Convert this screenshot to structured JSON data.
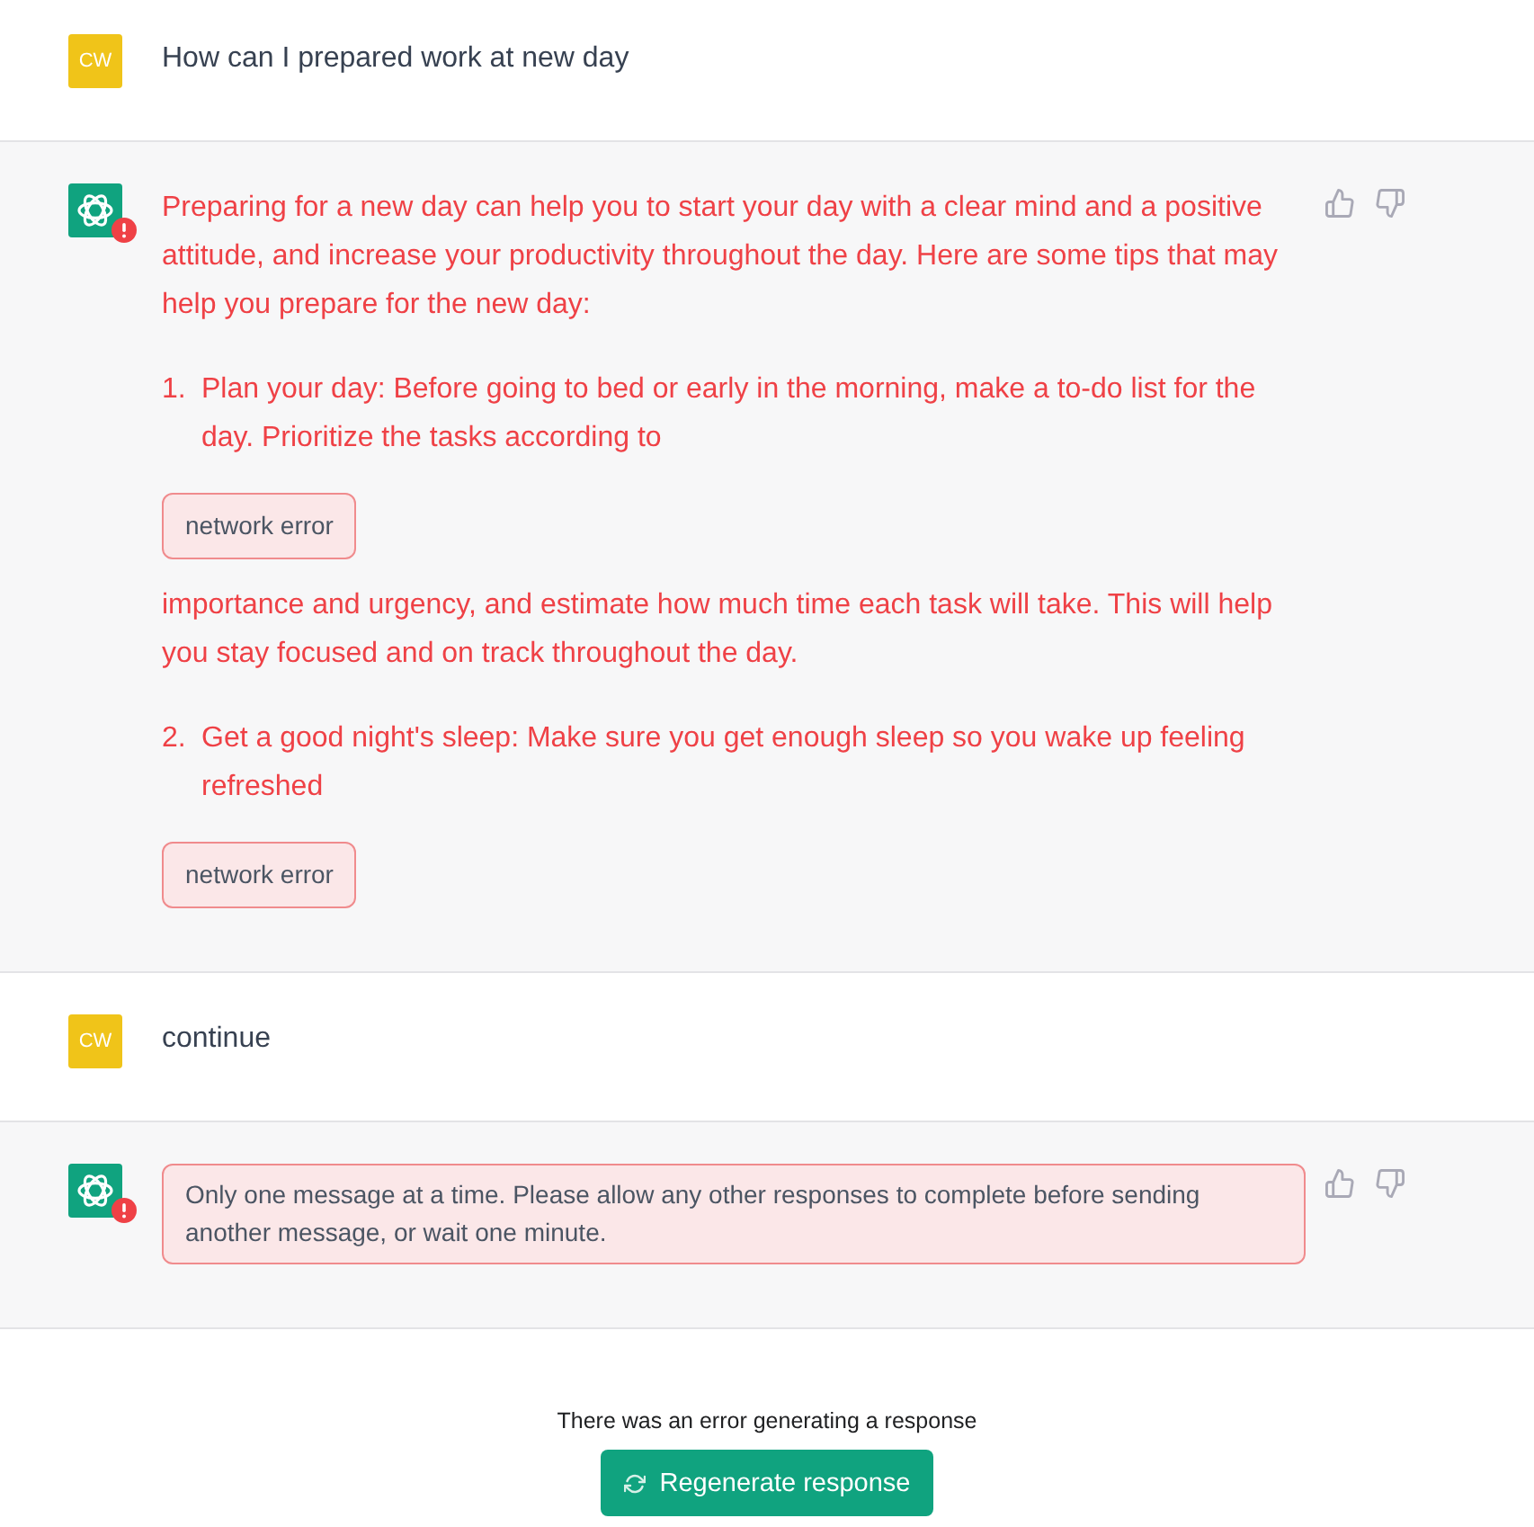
{
  "messages": [
    {
      "kind": "user",
      "avatar": "CW",
      "text": "How can I prepared work at new day"
    },
    {
      "kind": "assistant",
      "error": true,
      "blocks": [
        {
          "kind": "paragraph",
          "text": "Preparing for a new day can help you to start your day with a clear mind and a positive attitude, and increase your productivity throughout the day. Here are some tips that may help you prepare for the new day:"
        },
        {
          "kind": "list_item",
          "number": "1.",
          "text": "Plan your day: Before going to bed or early in the morning, make a to-do list for the day. Prioritize the tasks according to"
        },
        {
          "kind": "error_notice",
          "text": "network error"
        },
        {
          "kind": "paragraph",
          "text": "importance and urgency, and estimate how much time each task will take. This will help you stay focused and on track throughout the day."
        },
        {
          "kind": "list_item",
          "number": "2.",
          "text": "Get a good night's sleep: Make sure you get enough sleep so you wake up feeling refreshed"
        },
        {
          "kind": "error_notice",
          "text": "network error"
        }
      ]
    },
    {
      "kind": "user",
      "avatar": "CW",
      "text": "continue"
    },
    {
      "kind": "assistant",
      "error": true,
      "blocks": [
        {
          "kind": "error_message",
          "text": "Only one message at a time. Please allow any other responses to complete before sending another message, or wait one minute."
        }
      ]
    }
  ],
  "footer": {
    "error_text": "There was an error generating a response",
    "button": "Regenerate response"
  }
}
